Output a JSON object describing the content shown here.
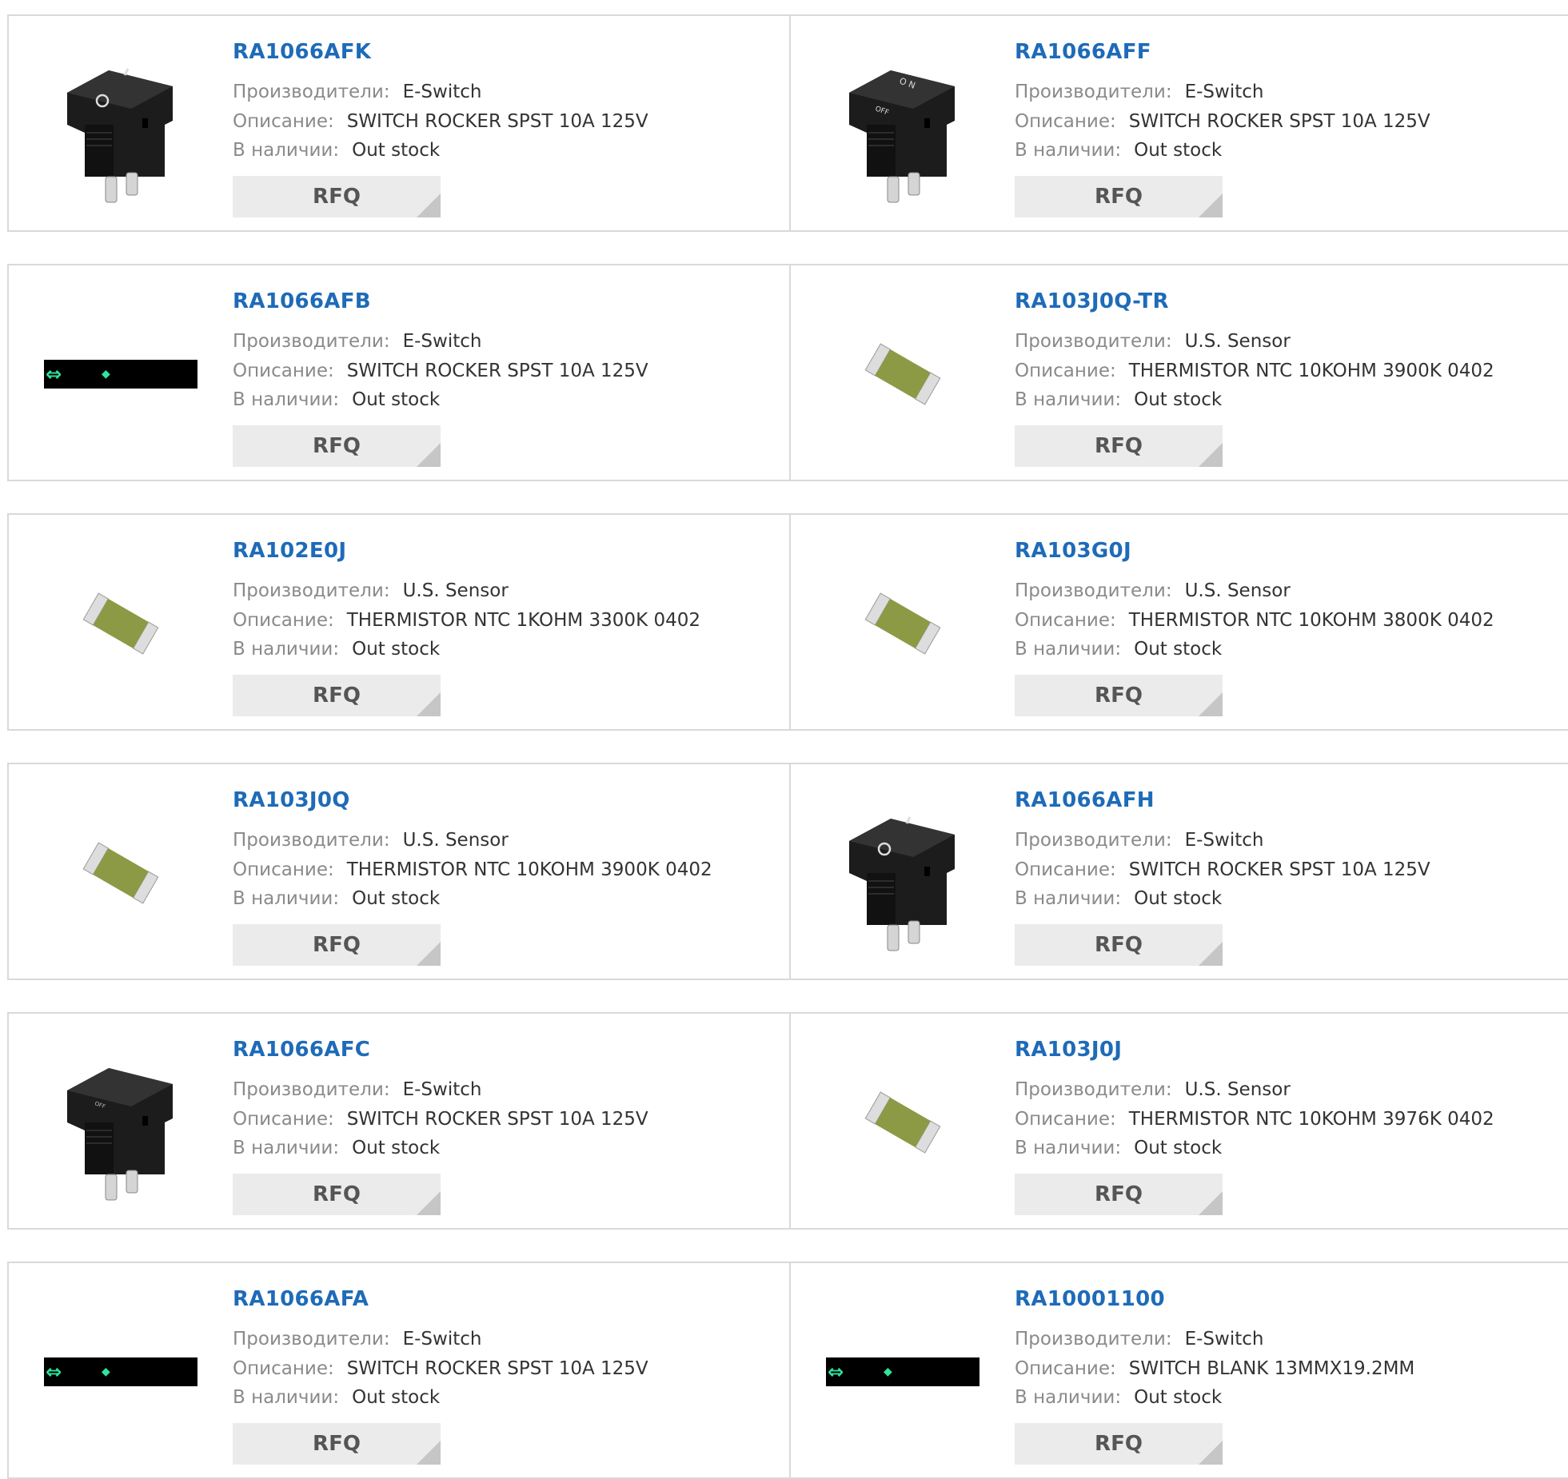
{
  "labels": {
    "manufacturer": "Производители:",
    "description": "Описание:",
    "stock": "В наличии:",
    "rfq": "RFQ"
  },
  "products": [
    {
      "part": "RA1066AFK",
      "manufacturer": "E-Switch",
      "description": "SWITCH ROCKER SPST 10A 125V",
      "stock": "Out stock",
      "image": "rocker-switch-o-i"
    },
    {
      "part": "RA1066AFF",
      "manufacturer": "E-Switch",
      "description": "SWITCH ROCKER SPST 10A 125V",
      "stock": "Out stock",
      "image": "rocker-switch-on-off"
    },
    {
      "part": "RA1066AFB",
      "manufacturer": "E-Switch",
      "description": "SWITCH ROCKER SPST 10A 125V",
      "stock": "Out stock",
      "image": "black-bar-placeholder"
    },
    {
      "part": "RA103J0Q-TR",
      "manufacturer": "U.S. Sensor",
      "description": "THERMISTOR NTC 10KOHM 3900K 0402",
      "stock": "Out stock",
      "image": "chip-thermistor"
    },
    {
      "part": "RA102E0J",
      "manufacturer": "U.S. Sensor",
      "description": "THERMISTOR NTC 1KOHM 3300K 0402",
      "stock": "Out stock",
      "image": "chip-thermistor"
    },
    {
      "part": "RA103G0J",
      "manufacturer": "U.S. Sensor",
      "description": "THERMISTOR NTC 10KOHM 3800K 0402",
      "stock": "Out stock",
      "image": "chip-thermistor"
    },
    {
      "part": "RA103J0Q",
      "manufacturer": "U.S. Sensor",
      "description": "THERMISTOR NTC 10KOHM 3900K 0402",
      "stock": "Out stock",
      "image": "chip-thermistor"
    },
    {
      "part": "RA1066AFH",
      "manufacturer": "E-Switch",
      "description": "SWITCH ROCKER SPST 10A 125V",
      "stock": "Out stock",
      "image": "rocker-switch-o-i"
    },
    {
      "part": "RA1066AFC",
      "manufacturer": "E-Switch",
      "description": "SWITCH ROCKER SPST 10A 125V",
      "stock": "Out stock",
      "image": "rocker-switch-blank"
    },
    {
      "part": "RA103J0J",
      "manufacturer": "U.S. Sensor",
      "description": "THERMISTOR NTC 10KOHM 3976K 0402",
      "stock": "Out stock",
      "image": "chip-thermistor"
    },
    {
      "part": "RA1066AFA",
      "manufacturer": "E-Switch",
      "description": "SWITCH ROCKER SPST 10A 125V",
      "stock": "Out stock",
      "image": "black-bar-placeholder"
    },
    {
      "part": "RA10001100",
      "manufacturer": "E-Switch",
      "description": "SWITCH BLANK 13MMX19.2MM",
      "stock": "Out stock",
      "image": "black-bar-placeholder"
    }
  ],
  "colors": {
    "link": "#1e6bb8",
    "label": "#8a8a8a",
    "value": "#333333",
    "border": "#d9d9d9",
    "rfq_bg": "#ebebeb"
  }
}
